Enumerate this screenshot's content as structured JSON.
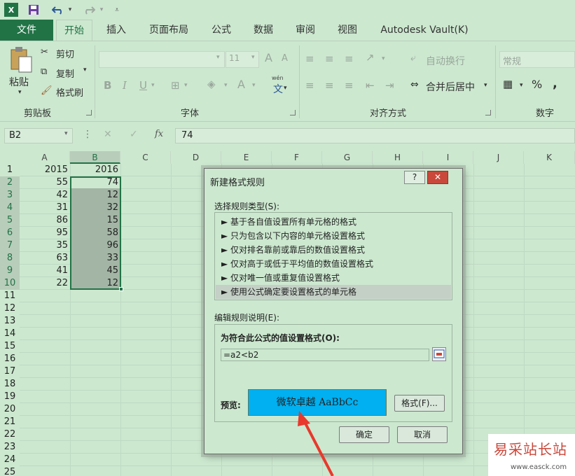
{
  "title_bar": {
    "quick_access": [
      "excel-icon",
      "save-icon",
      "undo-icon",
      "redo-icon",
      "customize-icon"
    ]
  },
  "tabs": [
    "文件",
    "开始",
    "插入",
    "页面布局",
    "公式",
    "数据",
    "审阅",
    "视图",
    "Autodesk Vault(K)"
  ],
  "ribbon": {
    "clipboard": {
      "paste": "粘贴",
      "cut": "剪切",
      "copy": "复制",
      "format_painter": "格式刷",
      "label": "剪贴板"
    },
    "font": {
      "size": "11",
      "bold": "B",
      "italic": "I",
      "underline": "U",
      "font_color": "A",
      "label": "字体",
      "wen": "wén",
      "wen_char": "文"
    },
    "alignment": {
      "wrap_text": "自动换行",
      "merge_center": "合并后居中",
      "label": "对齐方式"
    },
    "number": {
      "format": "常规",
      "percent": "%",
      "comma": ",",
      "label": "数字"
    }
  },
  "formula_bar": {
    "name_box": "B2",
    "fx": "fx",
    "value": "74"
  },
  "columns": [
    "A",
    "B",
    "C",
    "D",
    "E",
    "F",
    "G",
    "H",
    "I",
    "J",
    "K"
  ],
  "rows": [
    "1",
    "2",
    "3",
    "4",
    "5",
    "6",
    "7",
    "8",
    "9",
    "10",
    "11",
    "12",
    "13",
    "14",
    "15",
    "16",
    "17",
    "18",
    "19",
    "20",
    "21",
    "22",
    "23",
    "24",
    "25"
  ],
  "cells": {
    "A": [
      "2015",
      "55",
      "42",
      "31",
      "86",
      "95",
      "35",
      "63",
      "41",
      "22"
    ],
    "B": [
      "2016",
      "74",
      "12",
      "32",
      "15",
      "58",
      "96",
      "33",
      "45",
      "12"
    ]
  },
  "dialog": {
    "title": "新建格式规则",
    "help": "?",
    "close": "✕",
    "rule_type_label": "选择规则类型(S):",
    "rule_types": [
      "► 基于各自值设置所有单元格的格式",
      "► 只为包含以下内容的单元格设置格式",
      "► 仅对排名靠前或靠后的数值设置格式",
      "► 仅对高于或低于平均值的数值设置格式",
      "► 仅对唯一值或重复值设置格式",
      "► 使用公式确定要设置格式的单元格"
    ],
    "edit_label": "编辑规则说明(E):",
    "formula_label": "为符合此公式的值设置格式(O):",
    "formula_value": "=a2<b2",
    "preview_label": "预览:",
    "preview_text": "微软卓越  AaBbCc",
    "format_button": "格式(F)...",
    "ok": "确定",
    "cancel": "取消"
  },
  "watermark": {
    "text": "易采站长站",
    "url": "www.easck.com"
  },
  "colors": {
    "excel_green": "#217346",
    "preview_bg": "#00b0f0",
    "arrow": "#e8392c"
  }
}
